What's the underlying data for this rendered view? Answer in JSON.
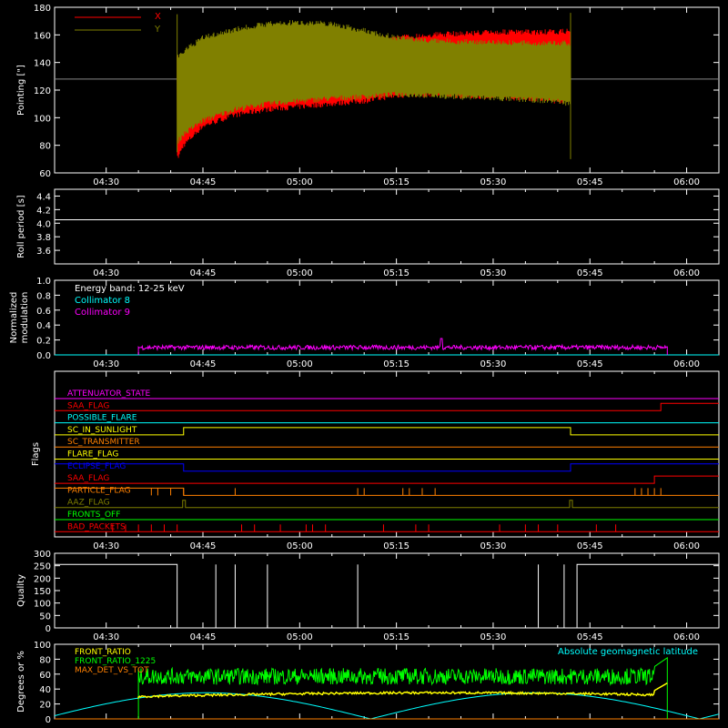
{
  "colors": {
    "background": "#000000",
    "axes": "#ffffff",
    "x_series": "#ff0000",
    "y_series": "#808000",
    "cyan": "#00ffff",
    "magenta": "#ff00ff",
    "green": "#00ff00",
    "yellow": "#ffff00",
    "orange": "#ff8000",
    "blue": "#0000ff",
    "red": "#ff0000",
    "olive": "#808000"
  },
  "time_ticks": [
    "04:30",
    "04:45",
    "05:00",
    "05:15",
    "05:30",
    "05:45",
    "06:00"
  ],
  "chart_data": [
    {
      "id": "pointing",
      "type": "line",
      "ylabel": "Pointing [\"]",
      "ylim": [
        60,
        180
      ],
      "yticks": [
        "60",
        "80",
        "100",
        "120",
        "140",
        "160",
        "180"
      ],
      "xlim": [
        "04:22",
        "06:05"
      ],
      "legend": {
        "placement": "top-left",
        "entries": [
          "X",
          "Y"
        ]
      },
      "reference_line": 128,
      "series": [
        {
          "name": "X",
          "color": "#ff0000",
          "x": [
            "04:41",
            "04:42",
            "04:45",
            "04:50",
            "04:55",
            "05:00",
            "05:05",
            "05:10",
            "05:15",
            "05:20",
            "05:25",
            "05:30",
            "05:35",
            "05:40",
            "05:42"
          ],
          "upper": [
            145,
            148,
            154,
            160,
            163,
            164,
            162,
            158,
            160,
            162,
            163,
            164,
            164,
            164,
            165
          ],
          "lower": [
            68,
            78,
            92,
            100,
            104,
            106,
            108,
            110,
            114,
            115,
            114,
            113,
            112,
            110,
            110
          ]
        },
        {
          "name": "Y",
          "color": "#808000",
          "x": [
            "04:41",
            "04:42",
            "04:45",
            "04:50",
            "04:55",
            "05:00",
            "05:05",
            "05:10",
            "05:15",
            "05:20",
            "05:25",
            "05:30",
            "05:35",
            "05:40",
            "05:42"
          ],
          "upper": [
            145,
            150,
            160,
            166,
            170,
            171,
            170,
            165,
            160,
            158,
            157,
            157,
            156,
            156,
            156
          ],
          "lower": [
            80,
            86,
            96,
            104,
            108,
            110,
            112,
            113,
            115,
            114,
            113,
            112,
            111,
            110,
            108
          ]
        }
      ]
    },
    {
      "id": "roll_period",
      "type": "line",
      "ylabel": "Roll period [s]",
      "ylim": [
        3.4,
        4.5
      ],
      "yticks": [
        "3.6",
        "3.8",
        "4.0",
        "4.2",
        "4.4"
      ],
      "series": [
        {
          "x": [
            "04:22",
            "06:05"
          ],
          "values": [
            4.05,
            4.05
          ],
          "color": "#ffffff"
        }
      ]
    },
    {
      "id": "modulation",
      "type": "line",
      "ylabel_line1": "Normalized",
      "ylabel_line2": "modulation",
      "ylim": [
        0,
        1.0
      ],
      "yticks": [
        "0.0",
        "0.2",
        "0.4",
        "0.6",
        "0.8",
        "1.0"
      ],
      "annotations": [
        "Energy band: 12-25 keV"
      ],
      "series": [
        {
          "name": "Collimator 8",
          "color": "#00ffff",
          "x": [
            "04:22",
            "06:05"
          ],
          "values": [
            0,
            0
          ]
        },
        {
          "name": "Collimator 9",
          "color": "#ff00ff",
          "x_start": "04:35",
          "x_end": "05:57",
          "mean": 0.1,
          "spike_at": "05:22",
          "spike_value": 0.22
        }
      ]
    },
    {
      "id": "flags",
      "type": "table",
      "ylabel": "Flags",
      "rows": [
        {
          "name": "ATTENUATOR_STATE",
          "color": "#ff00ff"
        },
        {
          "name": "SAA_FLAG",
          "color": "#ff0000"
        },
        {
          "name": "POSSIBLE_FLARE",
          "color": "#00ffff"
        },
        {
          "name": "SC_IN_SUNLIGHT",
          "color": "#ffff00"
        },
        {
          "name": "SC_TRANSMITTER",
          "color": "#ff8000"
        },
        {
          "name": "FLARE_FLAG",
          "color": "#ffff00"
        },
        {
          "name": "ECLIPSE_FLAG",
          "color": "#0000ff"
        },
        {
          "name": "SAA_FLAG",
          "color": "#ff0000"
        },
        {
          "name": "PARTICLE_FLAG",
          "color": "#ff8000"
        },
        {
          "name": "AAZ_FLAG",
          "color": "#808000"
        },
        {
          "name": "FRONTS_OFF",
          "color": "#00ff00"
        },
        {
          "name": "BAD_PACKETS",
          "color": "#ff0000"
        }
      ]
    },
    {
      "id": "quality",
      "type": "line",
      "ylabel": "Quality",
      "ylim": [
        0,
        300
      ],
      "yticks": [
        "0",
        "50",
        "100",
        "150",
        "200",
        "250",
        "300"
      ],
      "series": [
        {
          "color": "#ffffff",
          "high": 255,
          "low_from": "04:41",
          "low_to": "05:43",
          "spikes": [
            "04:47",
            "04:50",
            "04:55",
            "05:09",
            "05:37",
            "05:41"
          ]
        }
      ]
    },
    {
      "id": "ratios",
      "type": "line",
      "ylabel": "Degrees or %",
      "ylim": [
        0,
        100
      ],
      "yticks": [
        "0",
        "20",
        "40",
        "60",
        "80",
        "100"
      ],
      "annotations": [
        "Absolute geomagnetic latitude"
      ],
      "series": [
        {
          "name": "FRONT_RATIO",
          "color": "#ffff00",
          "mean": 30
        },
        {
          "name": "FRONT_RATIO_1225",
          "color": "#00ff00",
          "mean": 57
        },
        {
          "name": "MAX_DET_VS_TOT",
          "color": "#ff8000",
          "mean": 0
        },
        {
          "name": "Absolute geomagnetic latitude",
          "color": "#00ffff",
          "x": [
            "04:22",
            "04:30",
            "05:00",
            "05:20",
            "05:45",
            "06:03"
          ],
          "values": [
            0,
            18,
            33,
            0,
            33,
            0
          ]
        }
      ]
    }
  ]
}
